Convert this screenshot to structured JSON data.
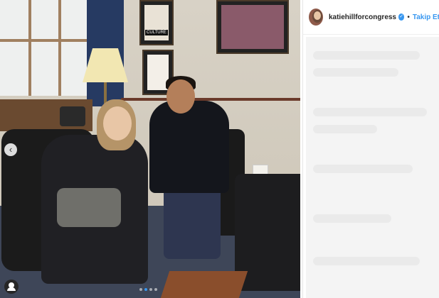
{
  "post": {
    "username": "katiehillforcongress",
    "separator": "•",
    "follow_label": "Takip Et",
    "verified": true,
    "carousel": {
      "total": 4,
      "active_index": 1,
      "prev_icon": "chevron-left-icon",
      "tag_icon": "user-tag-icon"
    },
    "photo_wall_art_text": "CULTURE"
  },
  "colors": {
    "accent": "#3897f0",
    "username_text": "#262626"
  }
}
